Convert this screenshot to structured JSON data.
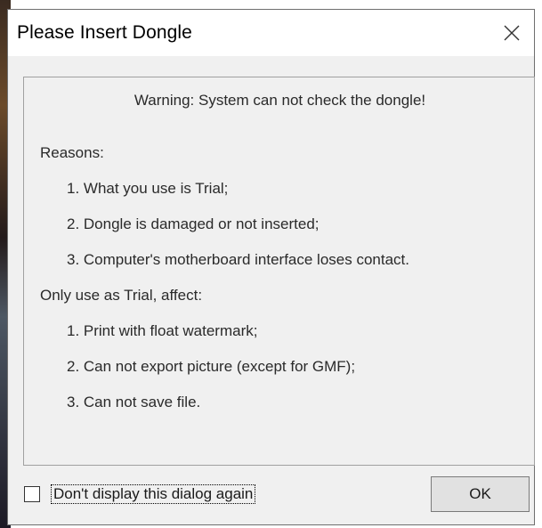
{
  "dialog": {
    "title": "Please Insert Dongle",
    "close_icon": "close-icon"
  },
  "content": {
    "warning": "Warning: System can not check the dongle!",
    "reasons_heading": "Reasons:",
    "reasons": [
      "1. What you use is Trial;",
      "2. Dongle is damaged or not inserted;",
      "3. Computer's motherboard interface loses contact."
    ],
    "trial_heading": "Only use as Trial, affect:",
    "trial_effects": [
      "1. Print with float watermark;",
      "2. Can not export picture (except for GMF);",
      "3. Can not save file."
    ]
  },
  "footer": {
    "checkbox_label": "Don't display this dialog again",
    "checkbox_checked": false,
    "ok_label": "OK"
  },
  "colors": {
    "dialog_bg": "#f0f0f0",
    "titlebar_bg": "#ffffff",
    "text": "#2a2a2a"
  }
}
